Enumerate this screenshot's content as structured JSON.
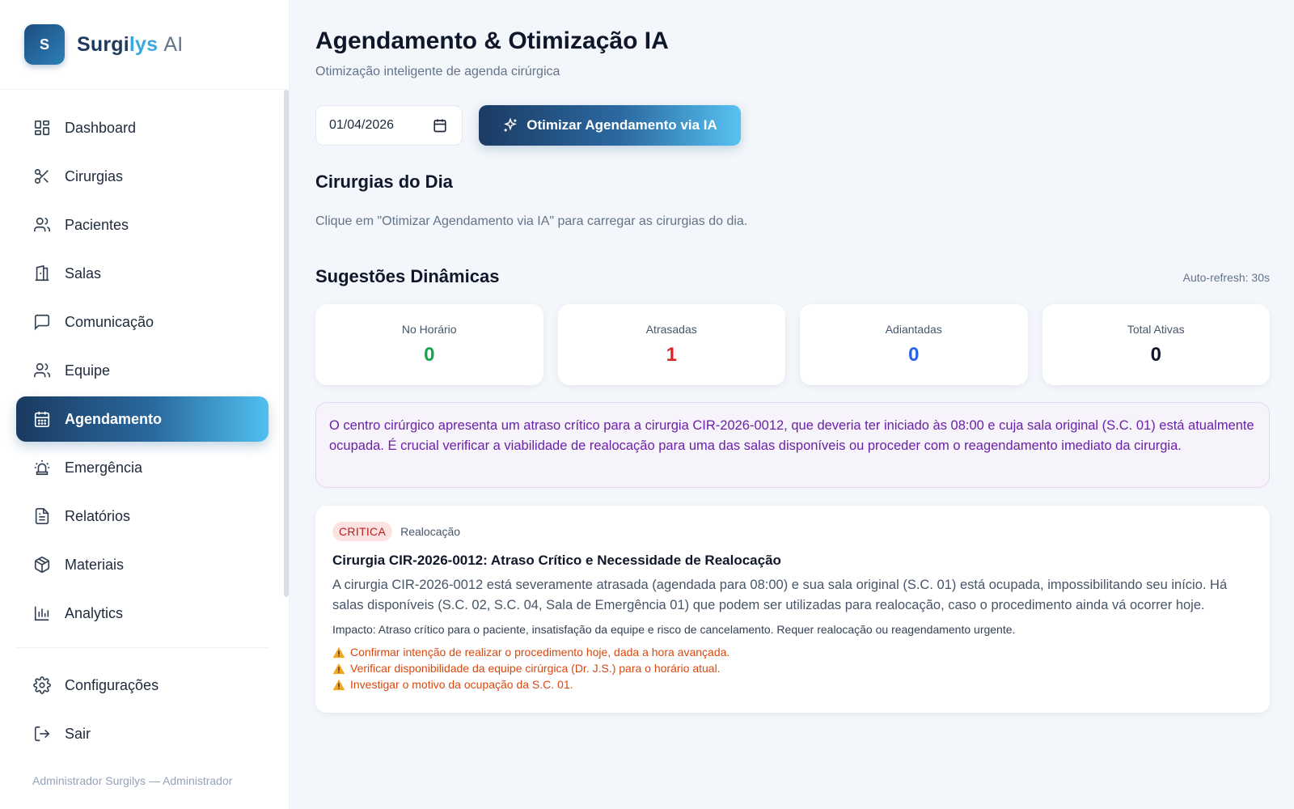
{
  "brand": {
    "logo_letter": "S",
    "name_part1": "Surgi",
    "name_part2": "lys",
    "name_suffix": "AI"
  },
  "sidebar": {
    "items": [
      {
        "label": "Dashboard",
        "icon": "dashboard-icon"
      },
      {
        "label": "Cirurgias",
        "icon": "scissors-icon"
      },
      {
        "label": "Pacientes",
        "icon": "users-icon"
      },
      {
        "label": "Salas",
        "icon": "door-icon"
      },
      {
        "label": "Comunicação",
        "icon": "message-icon"
      },
      {
        "label": "Equipe",
        "icon": "team-icon"
      },
      {
        "label": "Agendamento",
        "icon": "calendar-icon",
        "active": true
      },
      {
        "label": "Emergência",
        "icon": "siren-icon"
      },
      {
        "label": "Relatórios",
        "icon": "file-text-icon"
      },
      {
        "label": "Materiais",
        "icon": "package-icon"
      },
      {
        "label": "Analytics",
        "icon": "bar-chart-icon"
      }
    ],
    "bottom_items": [
      {
        "label": "Configurações",
        "icon": "gear-icon"
      },
      {
        "label": "Sair",
        "icon": "logout-icon"
      }
    ],
    "user": "Administrador Surgilys — Administrador"
  },
  "header": {
    "title": "Agendamento & Otimização IA",
    "subtitle": "Otimização inteligente de agenda cirúrgica"
  },
  "controls": {
    "date_value": "01/04/2026",
    "optimize_label": "Otimizar Agendamento via IA"
  },
  "surgeries": {
    "title": "Cirurgias do Dia",
    "hint": "Clique em \"Otimizar Agendamento via IA\" para carregar as cirurgias do dia."
  },
  "suggestions": {
    "title": "Sugestões Dinâmicas",
    "autorefresh": "Auto-refresh: 30s",
    "stats": [
      {
        "label": "No Horário",
        "value": "0",
        "color": "#16a34a"
      },
      {
        "label": "Atrasadas",
        "value": "1",
        "color": "#dc2626"
      },
      {
        "label": "Adiantadas",
        "value": "0",
        "color": "#2563eb"
      },
      {
        "label": "Total Ativas",
        "value": "0",
        "color": "#0f172a"
      }
    ],
    "summary": "O centro cirúrgico apresenta um atraso crítico para a cirurgia CIR-2026-0012, que deveria ter iniciado às 08:00 e cuja sala original (S.C. 01) está atualmente ocupada. É crucial verificar a viabilidade de realocação para uma das salas disponíveis ou proceder com o reagendamento imediato da cirurgia.",
    "card": {
      "badge": "CRITICA",
      "type": "Realocação",
      "title": "Cirurgia CIR-2026-0012: Atraso Crítico e Necessidade de Realocação",
      "description": "A cirurgia CIR-2026-0012 está severamente atrasada (agendada para 08:00) e sua sala original (S.C. 01) está ocupada, impossibilitando seu início. Há salas disponíveis (S.C. 02, S.C. 04, Sala de Emergência 01) que podem ser utilizadas para realocação, caso o procedimento ainda vá ocorrer hoje.",
      "impact": "Impacto: Atraso crítico para o paciente, insatisfação da equipe e risco de cancelamento. Requer realocação ou reagendamento urgente.",
      "actions": [
        "Confirmar intenção de realizar o procedimento hoje, dada a hora avançada.",
        "Verificar disponibilidade da equipe cirúrgica (Dr. J.S.) para o horário atual.",
        "Investigar o motivo da ocupação da S.C. 01."
      ]
    }
  }
}
